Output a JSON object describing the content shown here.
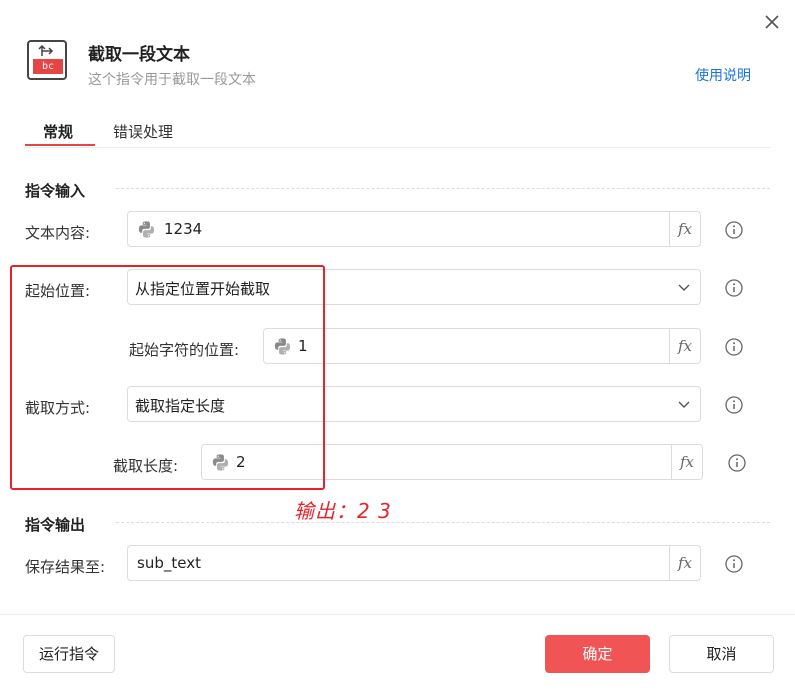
{
  "dialog": {
    "title": "截取一段文本",
    "subtitle": "这个指令用于截取一段文本",
    "help_link": "使用说明",
    "icon_badge": "bc"
  },
  "tabs": [
    {
      "label": "常规",
      "active": true
    },
    {
      "label": "错误处理",
      "active": false
    }
  ],
  "input_section": {
    "title": "指令输入",
    "text_content": {
      "label": "文本内容:",
      "value": "1234",
      "fx": "fx"
    },
    "start_position": {
      "label": "起始位置:",
      "value": "从指定位置开始截取"
    },
    "start_char_position": {
      "label": "起始字符的位置:",
      "value": "1",
      "fx": "fx"
    },
    "cut_method": {
      "label": "截取方式:",
      "value": "截取指定长度"
    },
    "cut_length": {
      "label": "截取长度:",
      "value": "2",
      "fx": "fx"
    }
  },
  "output_section": {
    "title": "指令输出",
    "save_result": {
      "label": "保存结果至:",
      "value": "sub_text",
      "fx": "fx"
    }
  },
  "annotation": {
    "text": "输出：2 3",
    "color": "#e5242a"
  },
  "footer": {
    "run_label": "运行指令",
    "ok_label": "确定",
    "cancel_label": "取消"
  },
  "colors": {
    "accent": "#f05454",
    "link": "#1a73d9"
  }
}
